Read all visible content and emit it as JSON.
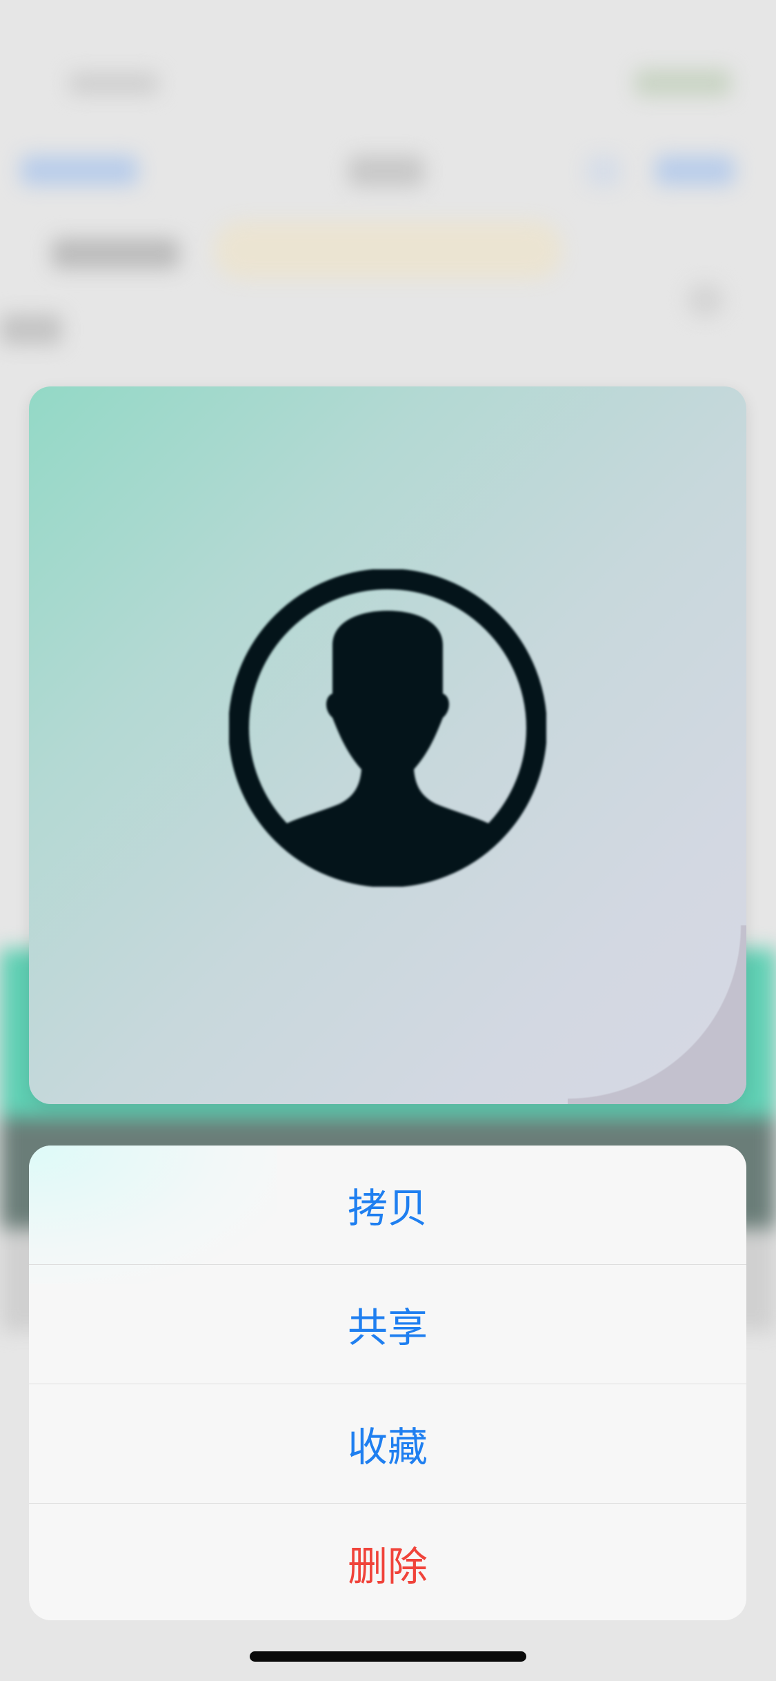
{
  "preview": {
    "icon": "user-avatar-icon",
    "gradient_colors": [
      "#93d9c6",
      "#c8d8dc",
      "#d6d8e4"
    ]
  },
  "action_sheet": {
    "items": [
      {
        "label": "拷贝",
        "style": "default"
      },
      {
        "label": "共享",
        "style": "default"
      },
      {
        "label": "收藏",
        "style": "default"
      },
      {
        "label": "删除",
        "style": "destructive"
      }
    ],
    "accent_color": "#1f7ff0",
    "destructive_color": "#f0433a"
  }
}
